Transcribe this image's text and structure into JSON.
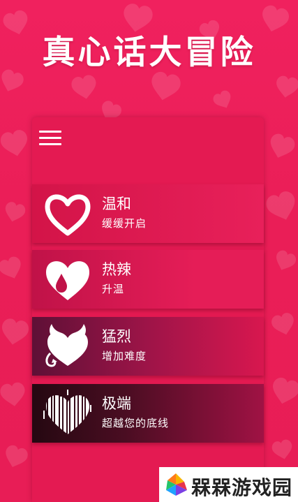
{
  "app": {
    "title": "真心话大冒险"
  },
  "menu": {
    "icon": "hamburger-icon"
  },
  "levels": [
    {
      "name": "温和",
      "desc": "缓缓开启",
      "icon": "heart-outline-icon"
    },
    {
      "name": "热辣",
      "desc": "升温",
      "icon": "heart-drop-icon"
    },
    {
      "name": "猛烈",
      "desc": "增加难度",
      "icon": "devil-heart-icon"
    },
    {
      "name": "极端",
      "desc": "超越您的底线",
      "icon": "glitch-heart-icon"
    }
  ],
  "watermark": {
    "text": "槑槑游戏园"
  },
  "colors": {
    "background": "#f0215e",
    "panel": "#e41a52",
    "text": "#ffffff"
  }
}
